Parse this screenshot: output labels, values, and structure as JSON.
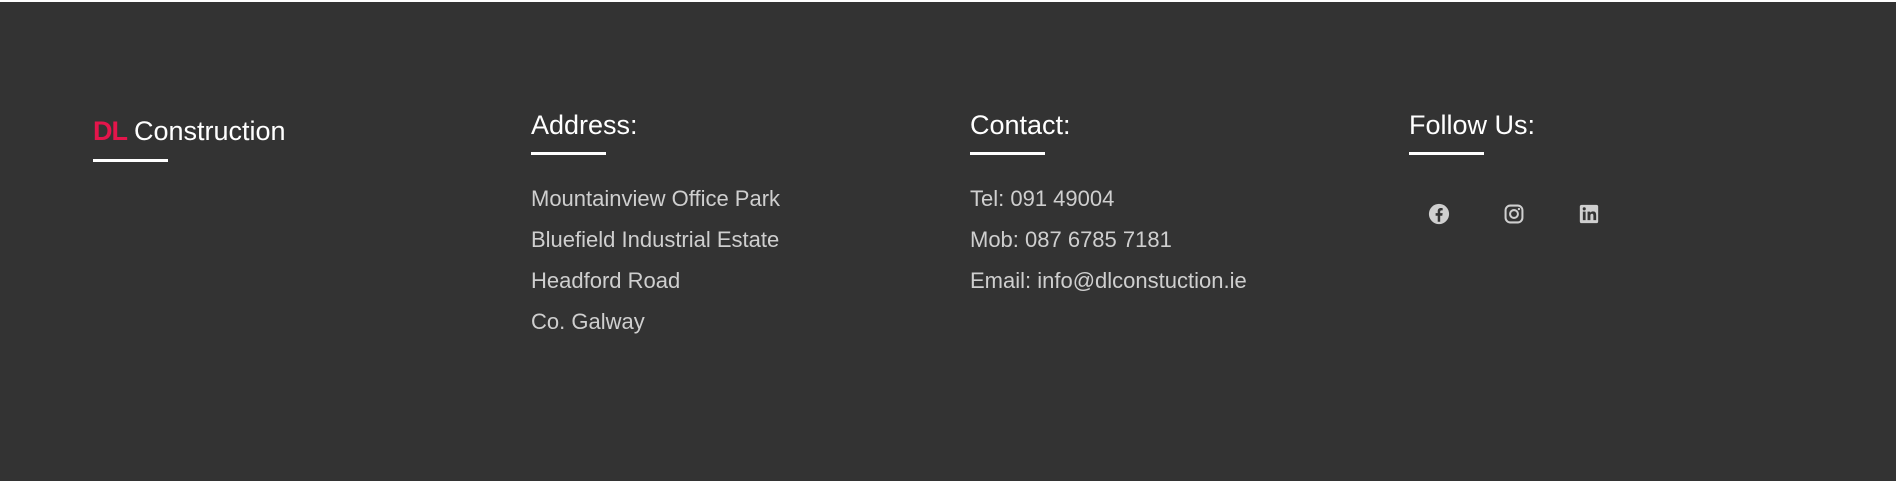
{
  "footer": {
    "brand": {
      "mark": "DL",
      "name": "Construction"
    },
    "address": {
      "heading": "Address:",
      "lines": [
        "Mountainview Office Park",
        "Bluefield Industrial Estate",
        "Headford Road",
        "Co. Galway"
      ]
    },
    "contact": {
      "heading": "Contact:",
      "lines": [
        "Tel: 091 49004",
        "Mob: 087 6785 7181",
        "Email: info@dlconstuction.ie"
      ]
    },
    "follow": {
      "heading": "Follow Us:",
      "icons": [
        "facebook-icon",
        "instagram-icon",
        "linkedin-icon"
      ]
    }
  },
  "colors": {
    "background": "#333333",
    "brand_accent": "#e4154b",
    "heading_text": "#ffffff",
    "body_text": "#cfcfcf"
  }
}
